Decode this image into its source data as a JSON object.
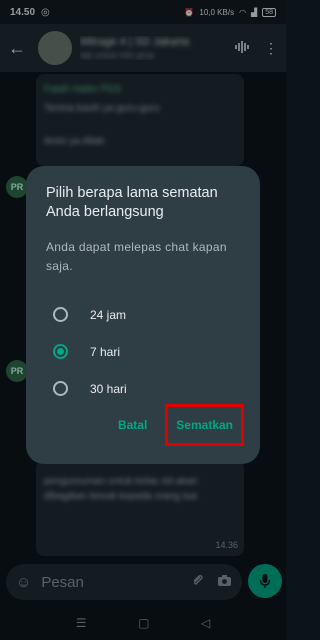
{
  "status_bar": {
    "time": "14.50",
    "speed": "10,0 KB/s",
    "battery": "58"
  },
  "header": {
    "title": "Mitrage 4 | SD Jakarta",
    "subtitle": "tap untuk info grup"
  },
  "messages": [
    {
      "quoted_name": "Fatah Halim PDS",
      "text": "Terima kasih ya guru-guru",
      "extra": "Amin ya Allah"
    },
    {
      "text": "pengumuman untuk kelas 4A akan dibagikan besok kepada orang tua",
      "time": "14.36"
    }
  ],
  "sender_initials": "PR",
  "dialog": {
    "title": "Pilih berapa lama sematan Anda berlangsung",
    "subtitle": "Anda dapat melepas chat kapan saja.",
    "options": [
      {
        "label": "24 jam",
        "selected": false
      },
      {
        "label": "7 hari",
        "selected": true
      },
      {
        "label": "30 hari",
        "selected": false
      }
    ],
    "cancel_label": "Batal",
    "confirm_label": "Sematkan"
  },
  "input": {
    "placeholder": "Pesan"
  },
  "colors": {
    "accent": "#00a884",
    "highlight": "#e00000",
    "dialog_bg": "#2f3d45"
  }
}
